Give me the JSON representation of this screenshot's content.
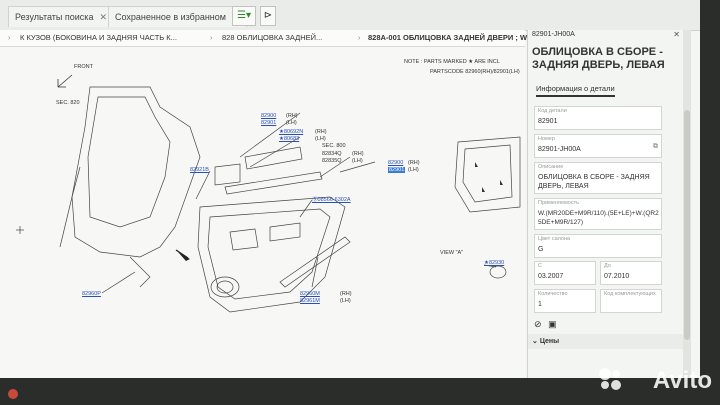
{
  "tabs": [
    {
      "label": "Результаты поиска"
    },
    {
      "label": "Сохраненное в избранном"
    }
  ],
  "breadcrumb": [
    {
      "label": "К КУЗОВ (БОКОВИНА И ЗАДНЯЯ ЧАСТЬ К..."
    },
    {
      "label": "828 ОБЛИЦОВКА ЗАДНЕЙ..."
    },
    {
      "label": "828А-001 ОБЛИЦОВКА ЗАДНЕЙ ДВЕРИ ; W..."
    }
  ],
  "diagram": {
    "note": "NOTE : PARTS MARKED ★ ARE INCL",
    "partscode": "PARTSCODE  82960(RH)/82901(LH)",
    "front": "FRONT",
    "sec820": "SEC. 820",
    "sec800": "SEC. 800",
    "view": "VIEW \"A\"",
    "labels": {
      "p82900": "82900",
      "p82901": "82901",
      "rh": "(RH)",
      "lh": "(LH)",
      "p80692n": "80692N",
      "p80683": "80683",
      "p82834q": "82834Q",
      "p82835q": "82835Q",
      "p82900b": "82900",
      "p82901b": "82901",
      "p82921b": "82921B",
      "p08566": "08566-6302A",
      "p82960m": "82960M",
      "p82961m": "82961M",
      "p82930": "82930",
      "p82960p": "82960P"
    }
  },
  "panel": {
    "header": "82901-JH00A",
    "title": "ОБЛИЦОВКА В СБОРЕ - ЗАДНЯЯ ДВЕРЬ, ЛЕВАЯ",
    "tab": "Информация о детали",
    "fields": {
      "code_k": "Код детали",
      "code_v": "82901",
      "num_k": "Номер",
      "num_v": "82901-JH00A",
      "desc_k": "Описание",
      "desc_v": "ОБЛИЦОВКА В СБОРЕ - ЗАДНЯЯ ДВЕРЬ, ЛЕВАЯ",
      "app_k": "Применяемость",
      "app_v": "W.(MR20DE+M9R/110).(5E+LE)+W.(QR25DE+M9R/127)",
      "color_k": "Цвет салона",
      "color_v": "G",
      "from_k": "С",
      "from_v": "03.2007",
      "to_k": "До",
      "to_v": "07.2010",
      "qty_k": "Количество",
      "qty_v": "1",
      "comp_k": "Код комплектующих",
      "comp_v": ""
    },
    "prices": "Цены"
  },
  "watermark": "Avito"
}
